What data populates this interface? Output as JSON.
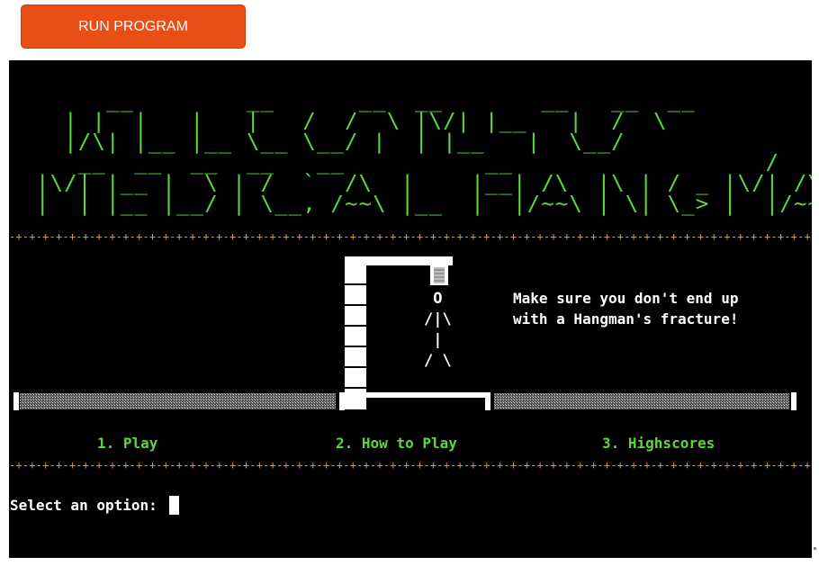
{
  "toolbar": {
    "run_label": "RUN PROGRAM",
    "accent": "#e84e16"
  },
  "terminal": {
    "banner_lines": [
      "     __        __      __  __       __   __  __",
      "  | |  |   |   |   /  /  \\ |\\/| |__   |  /  \\",
      "  |/\\| |__ |__ \\__ \\__/ |  | |__   |  \\__/",
      "   __  __  __  __   __          __                  /",
      "|\\/| |__ |  \\ | /  `  /\\  |    |__| /\\  |\\ | / _ |\\/| /\\  |\\ |/",
      "|  | |__ |__/ | \\__, /~~\\ |__  |  |/~~\\ | \\| \\_> |  |/~~\\ | \\|."
    ],
    "divider": "-+-+-+-+-+-+-+-+-+-+-+-+-+-+-+-+-+-+-+-+-+-+-+-+-+-+-+-+-+-+-+-+-+-+-+-+-+-+-+-+-+-+-+-+-+-+-+-+-+-+-+-+-+-+-+-+-+-+-+-+-+-+-+-+-+-+-+-+-+-+-+-+-+-+-+-+-+-+-+-+-+-+-+-+-+",
    "figure_lines": [
      " O",
      "/|\\",
      " |",
      "/ \\"
    ],
    "tagline_lines": [
      "Make sure you don't end up",
      "with a Hangman's fracture!"
    ],
    "menu": [
      "1. Play",
      "2. How to Play",
      "3. Highscores"
    ],
    "prompt": "Select an option: "
  },
  "colors": {
    "banner": "#5ed63d",
    "divider": "#d8a020",
    "text": "#ffffff",
    "background": "#000000"
  }
}
